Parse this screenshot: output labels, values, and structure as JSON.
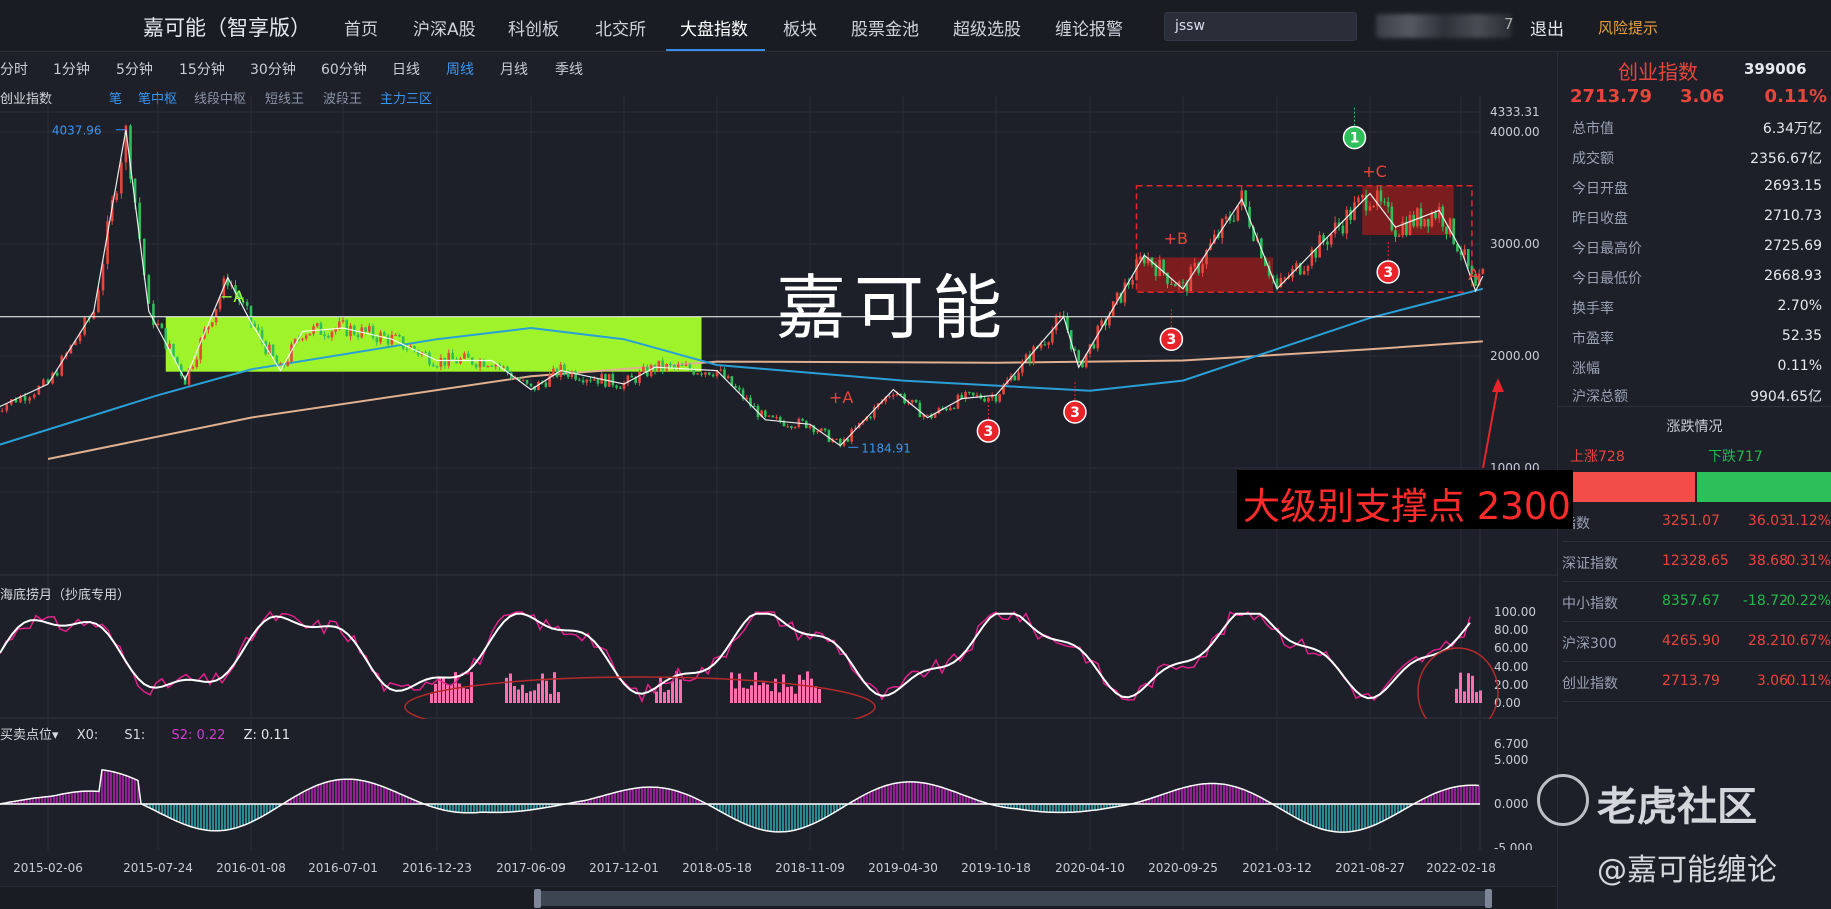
{
  "app": {
    "title": "嘉可能（智享版）"
  },
  "nav": {
    "items": [
      "首页",
      "沪深A股",
      "科创板",
      "北交所",
      "大盘指数",
      "板块",
      "股票金池",
      "超级选股",
      "缠论报警"
    ],
    "active": "大盘指数",
    "search_value": "jssw",
    "blurred_digit": "7",
    "logout": "退出",
    "risk": "风险提示"
  },
  "periods": {
    "items": [
      "分时",
      "1分钟",
      "5分钟",
      "15分钟",
      "30分钟",
      "60分钟",
      "日线",
      "周线",
      "月线",
      "季线"
    ],
    "active": "周线"
  },
  "indicators": {
    "chart_name": "创业指数",
    "items": [
      "笔",
      "笔中枢",
      "线段中枢",
      "短线王",
      "波段王",
      "主力三区"
    ]
  },
  "chart_data": [
    {
      "type": "candlestick",
      "title": "创业指数",
      "period": "周线",
      "y_ticks": [
        4333.31,
        4000.0,
        3000.0,
        2000.0,
        1000.0,
        789.14
      ],
      "ylim": [
        789.14,
        4333.31
      ],
      "x_ticks": [
        "2015-02-06",
        "2015-07-24",
        "2016-01-08",
        "2016-07-01",
        "2016-12-23",
        "2017-06-09",
        "2017-12-01",
        "2018-05-18",
        "2018-11-09",
        "2019-04-30",
        "2019-10-18",
        "2020-04-10",
        "2020-09-25",
        "2021-03-12",
        "2021-08-27",
        "2022-02-18"
      ],
      "price_series": [
        [
          "2014-11-14",
          1520
        ],
        [
          "2015-02-06",
          1750
        ],
        [
          "2015-04-17",
          2400
        ],
        [
          "2015-06-05",
          4037.96
        ],
        [
          "2015-07-10",
          2400
        ],
        [
          "2015-09-11",
          1790
        ],
        [
          "2015-11-27",
          2700
        ],
        [
          "2016-01-08",
          2300
        ],
        [
          "2016-03-04",
          1870
        ],
        [
          "2016-04-15",
          2220
        ],
        [
          "2016-07-01",
          2250
        ],
        [
          "2016-09-30",
          2150
        ],
        [
          "2016-12-23",
          1960
        ],
        [
          "2017-03-31",
          1960
        ],
        [
          "2017-06-09",
          1700
        ],
        [
          "2017-08-04",
          1870
        ],
        [
          "2017-12-01",
          1750
        ],
        [
          "2018-01-26",
          1900
        ],
        [
          "2018-05-18",
          1870
        ],
        [
          "2018-08-17",
          1430
        ],
        [
          "2018-11-09",
          1390
        ],
        [
          "2019-01-04",
          1200
        ],
        [
          "2019-04-12",
          1700
        ],
        [
          "2019-06-14",
          1450
        ],
        [
          "2019-08-16",
          1620
        ],
        [
          "2019-10-18",
          1650
        ],
        [
          "2020-02-21",
          2350
        ],
        [
          "2020-03-20",
          1900
        ],
        [
          "2020-07-17",
          2900
        ],
        [
          "2020-09-25",
          2600
        ],
        [
          "2021-01-08",
          3400
        ],
        [
          "2021-03-12",
          2600
        ],
        [
          "2021-08-27",
          3450
        ],
        [
          "2021-10-15",
          3150
        ],
        [
          "2022-01-07",
          3300
        ],
        [
          "2022-02-18",
          2950
        ],
        [
          "2022-03-18",
          2580
        ],
        [
          "2022-04-01",
          2713.79
        ]
      ],
      "ma_long": [
        [
          "2015-02-06",
          1080
        ],
        [
          "2016-01-08",
          1450
        ],
        [
          "2017-06-09",
          1820
        ],
        [
          "2018-05-18",
          1950
        ],
        [
          "2019-10-18",
          1940
        ],
        [
          "2020-09-25",
          1960
        ],
        [
          "2021-08-27",
          2060
        ],
        [
          "2022-04-01",
          2130
        ]
      ],
      "ma_mid": [
        [
          "2014-11-14",
          1190
        ],
        [
          "2015-07-24",
          1650
        ],
        [
          "2016-01-08",
          1880
        ],
        [
          "2016-12-23",
          2150
        ],
        [
          "2017-06-09",
          2250
        ],
        [
          "2017-12-01",
          2150
        ],
        [
          "2018-05-18",
          1920
        ],
        [
          "2019-04-30",
          1780
        ],
        [
          "2020-04-10",
          1690
        ],
        [
          "2020-09-25",
          1780
        ],
        [
          "2021-08-27",
          2340
        ],
        [
          "2022-04-01",
          2600
        ]
      ],
      "markers": [
        {
          "label": "4037.96",
          "date": "2015-06-05",
          "value": 4037.96,
          "color": "#3a95f0"
        },
        {
          "label": "1184.91",
          "date": "2019-01-04",
          "value": 1184.91,
          "color": "#3a95f0"
        },
        {
          "label": "−A",
          "date": "2015-11-13",
          "value": 2480,
          "color": "#9dff3a"
        },
        {
          "label": "+A",
          "date": "2018-12-14",
          "value": 1580,
          "color": "#e8453c"
        },
        {
          "label": "+B",
          "date": "2020-08-21",
          "value": 3000,
          "color": "#e8453c"
        },
        {
          "label": "+C",
          "date": "2021-08-13",
          "value": 3600,
          "color": "#e8453c"
        },
        {
          "label": "A",
          "date": "2022-03-04",
          "value": 2680,
          "color": "#e8453c"
        }
      ],
      "signals": [
        {
          "label": "1",
          "date": "2021-07-30",
          "value": 3950,
          "color": "#2cbf5a"
        },
        {
          "label": "3",
          "date": "2019-10-04",
          "value": 1330,
          "color": "#e8242a"
        },
        {
          "label": "3",
          "date": "2020-03-13",
          "value": 1500,
          "color": "#e8242a"
        },
        {
          "label": "3",
          "date": "2020-09-04",
          "value": 2150,
          "color": "#e8242a"
        },
        {
          "label": "3",
          "date": "2021-10-01",
          "value": 2750,
          "color": "#e8242a"
        }
      ],
      "zones": [
        {
          "color": "#a5ff2b",
          "x0": "2015-08-07",
          "x1": "2018-04-20",
          "y0": 1860,
          "y1": 2350
        },
        {
          "color": "#9b1c1c",
          "x0": "2020-07-03",
          "x1": "2021-03-05",
          "y0": 2570,
          "y1": 2880
        },
        {
          "color": "#9b1c1c",
          "x0": "2021-08-13",
          "x1": "2022-02-04",
          "y0": 3080,
          "y1": 3520
        }
      ],
      "support_level": 2350
    },
    {
      "type": "line",
      "title": "海底捞月（抄底专用）",
      "y_ticks": [
        100.0,
        80.0,
        60.0,
        40.0,
        20.0,
        0.0
      ],
      "ylim": [
        0,
        100
      ]
    },
    {
      "type": "bar",
      "title": "买卖点位",
      "y_ticks": [
        6.7,
        5.0,
        0.0,
        -5.0
      ],
      "ylim": [
        -5,
        6.7
      ],
      "legend": [
        {
          "label": "X0:",
          "value": ""
        },
        {
          "label": "S1:",
          "value": ""
        },
        {
          "label": "S2:",
          "value": "0.22"
        },
        {
          "label": "Z:",
          "value": "0.11"
        }
      ]
    }
  ],
  "annotation": {
    "text": "大级别支撑点 2300"
  },
  "watermark": {
    "brand": "嘉可能",
    "community": "老虎社区",
    "author": "@嘉可能缠论"
  },
  "right_panel": {
    "name": "创业指数",
    "code": "399006",
    "price": "2713.79",
    "change": "3.06",
    "change_pct": "0.11%",
    "stats": [
      {
        "k": "总市值",
        "v": "6.34万亿"
      },
      {
        "k": "成交额",
        "v": "2356.67亿"
      },
      {
        "k": "今日开盘",
        "v": "2693.15"
      },
      {
        "k": "昨日收盘",
        "v": "2710.73"
      },
      {
        "k": "今日最高价",
        "v": "2725.69"
      },
      {
        "k": "今日最低价",
        "v": "2668.93"
      },
      {
        "k": "换手率",
        "v": "2.70%"
      },
      {
        "k": "市盈率",
        "v": "52.35"
      },
      {
        "k": "涨幅",
        "v": "0.11%"
      }
    ],
    "total": {
      "k": "沪深总额",
      "v": "9904.65亿"
    },
    "zd_title": "涨跌情况",
    "up": "上涨728",
    "down": "下跌717",
    "indices": [
      {
        "name": "指数",
        "price": "3251.07",
        "change": "36.03",
        "pct": "1.12%",
        "dir": "up"
      },
      {
        "name": "深证指数",
        "price": "12328.65",
        "change": "38.68",
        "pct": "0.31%",
        "dir": "up"
      },
      {
        "name": "中小指数",
        "price": "8357.67",
        "change": "-18.72",
        "pct": "-0.22%",
        "dir": "down"
      },
      {
        "name": "沪深300",
        "price": "4265.90",
        "change": "28.21",
        "pct": "0.67%",
        "dir": "up"
      },
      {
        "name": "创业指数",
        "price": "2713.79",
        "change": "3.06",
        "pct": "0.11%",
        "dir": "up"
      }
    ]
  }
}
